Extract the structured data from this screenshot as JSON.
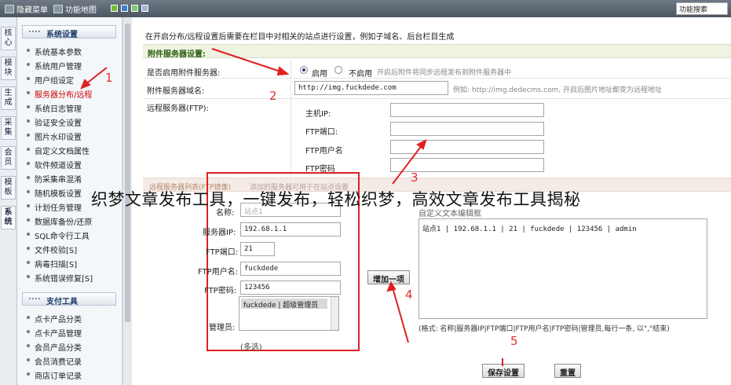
{
  "topbar": {
    "hide_menu": "隐藏菜单",
    "function_map": "功能地图",
    "search_value": "功能搜索",
    "swatches": [
      "#6fbf2f",
      "#3a7fd0",
      "#7bc96f",
      "#9db7d6"
    ]
  },
  "vertical_tabs": [
    "核心",
    "模块",
    "生成",
    "采集",
    "会员",
    "模板",
    "系统"
  ],
  "sidebar": {
    "section1": "系统设置",
    "items1": [
      "系统基本参数",
      "系统用户管理",
      "用户组设定",
      "服务器分布/远程",
      "系统日志管理",
      "验证安全设置",
      "图片水印设置",
      "自定义文档属性",
      "软件频道设置",
      "防采集串混淆",
      "随机模板设置",
      "计划任务管理",
      "数据库备份/还原",
      "SQL命令行工具",
      "文件校验[S]",
      "病毒扫描[S]",
      "系统错误修复[S]"
    ],
    "section2": "支付工具",
    "items2": [
      "点卡产品分类",
      "点卡产品管理",
      "会员产品分类",
      "会员消费记录",
      "商店订单记录"
    ]
  },
  "main": {
    "intro": "在开启分布/远程设置后需要在栏目中对相关的站点进行设置，例如子域名、后台栏目生成",
    "section_attach": "附件服务器设置:",
    "enable_label": "是否启用附件服务器:",
    "enable_on": "启用",
    "enable_off": "不启用",
    "enable_hint": "开启后附件将同步远程发布到附件服务器中",
    "domain_label": "附件服务器域名:",
    "domain_value": "http://img.fuckdede.com",
    "domain_hint": "例如: http://img.dedecms.com, 开启后图片地址都变为远程地址",
    "ftp_label": "远程服务器(FTP):",
    "host_label": "主机IP:",
    "port_label": "FTP端口:",
    "user_label": "FTP用户名",
    "pass_label": "FTP密码",
    "section_remote": "远程服务器列表(FTP镜像)",
    "section_remote_hint": "添加的服务器可用于在站点设置",
    "custom_list_label": "自定义文本编辑框",
    "form": {
      "name_label": "名称:",
      "name_placeholder": "站点1",
      "ip_label": "服务器IP:",
      "ip_value": "192.68.1.1",
      "port_label": "FTP端口:",
      "port_value": "21",
      "user_label": "FTP用户名:",
      "user_value": "fuckdede",
      "pass_label": "FTP密码:",
      "pass_value": "123456",
      "admin_label": "管理员:",
      "admin_option": "fuckdede | 超级管理员",
      "multi_hint": "(多选)"
    },
    "add_button": "增加一项",
    "textarea_value": "站点1 | 192.68.1.1 | 21 | fuckdede | 123456 | admin",
    "format_hint": "(格式: 名称|服务器IP|FTP端口|FTP用户名|FTP密码|管理员,每行一条, 以\",\"结束)",
    "save_button": "保存设置",
    "reset_button": "重置"
  },
  "annotations": [
    "1",
    "2",
    "3",
    "4",
    "5"
  ],
  "overlay_caption": "织梦文章发布工具，一键发布，轻松织梦，高效文章发布工具揭秘"
}
